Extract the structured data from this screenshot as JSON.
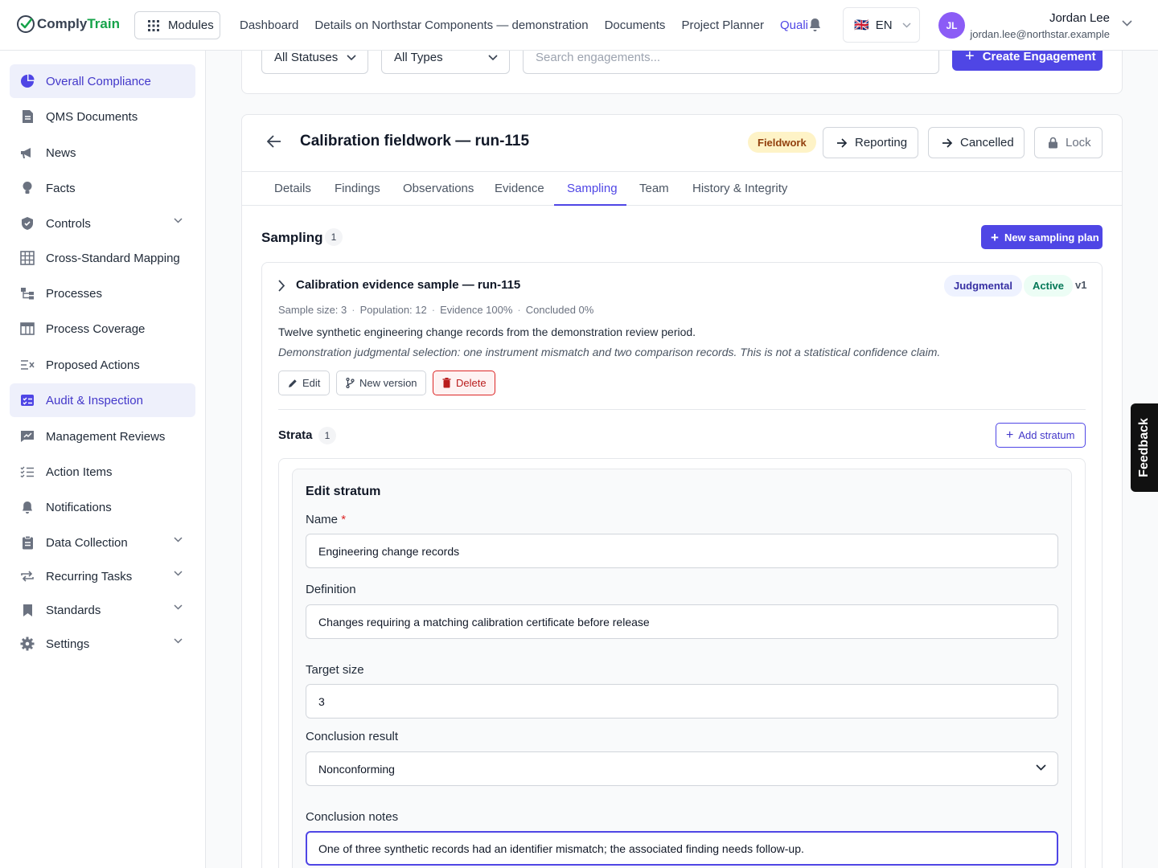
{
  "app": {
    "logo_part1": "Comply",
    "logo_part2": "Train",
    "modules_label": "Modules"
  },
  "topnav": {
    "items": [
      "Dashboard",
      "Details on Northstar Components — demonstration",
      "Documents",
      "Project Planner",
      "Quali"
    ],
    "active_index": 4
  },
  "lang": {
    "flag": "🇬🇧",
    "code": "EN"
  },
  "user": {
    "initials": "JL",
    "name": "Jordan Lee",
    "email": "jordan.lee@northstar.example"
  },
  "sidebar": {
    "items": [
      {
        "label": "Overall Compliance",
        "icon": "pie-chart-icon",
        "active": true
      },
      {
        "label": "QMS Documents",
        "icon": "document-icon"
      },
      {
        "label": "News",
        "icon": "megaphone-icon"
      },
      {
        "label": "Facts",
        "icon": "lightbulb-icon"
      },
      {
        "label": "Controls",
        "icon": "shield-icon",
        "expandable": true
      },
      {
        "label": "Cross-Standard Mapping",
        "icon": "grid-icon"
      },
      {
        "label": "Processes",
        "icon": "process-icon"
      },
      {
        "label": "Process Coverage",
        "icon": "table-icon"
      },
      {
        "label": "Proposed Actions",
        "icon": "list-x-icon"
      },
      {
        "label": "Audit & Inspection",
        "icon": "checklist-icon",
        "active": true
      },
      {
        "label": "Management Reviews",
        "icon": "chart-icon"
      },
      {
        "label": "Action Items",
        "icon": "list-check-icon"
      },
      {
        "label": "Notifications",
        "icon": "bell-icon"
      },
      {
        "label": "Data Collection",
        "icon": "clipboard-icon",
        "expandable": true
      },
      {
        "label": "Recurring Tasks",
        "icon": "repeat-icon",
        "expandable": true
      },
      {
        "label": "Standards",
        "icon": "bookmark-icon",
        "expandable": true
      },
      {
        "label": "Settings",
        "icon": "gear-icon",
        "expandable": true
      }
    ]
  },
  "filters": {
    "status": "All Statuses",
    "type": "All Types",
    "search_placeholder": "Search engagements...",
    "create_label": "Create Engagement"
  },
  "engagement": {
    "title": "Calibration fieldwork — run-115",
    "status_badge": "Fieldwork",
    "buttons": {
      "reporting": "Reporting",
      "cancelled": "Cancelled",
      "lock": "Lock"
    },
    "tabs": [
      "Details",
      "Findings",
      "Observations",
      "Evidence",
      "Sampling",
      "Team",
      "History & Integrity"
    ],
    "active_tab": "Sampling"
  },
  "sampling": {
    "title": "Sampling",
    "count": "1",
    "new_plan_label": "New sampling plan",
    "plan": {
      "title": "Calibration evidence sample — run-115",
      "method": "Judgmental",
      "status": "Active",
      "version": "v1",
      "sample_size": "Sample size: 3",
      "population": "Population: 12",
      "evidence": "Evidence 100%",
      "concluded": "Concluded 0%",
      "description": "Twelve synthetic engineering change records from the demonstration review period.",
      "note": "Demonstration judgmental selection: one instrument mismatch and two comparison records. This is not a statistical confidence claim.",
      "edit_label": "Edit",
      "new_version_label": "New version",
      "delete_label": "Delete"
    },
    "strata": {
      "title": "Strata",
      "count": "1",
      "add_label": "Add stratum"
    }
  },
  "edit_stratum": {
    "title": "Edit stratum",
    "name_label": "Name",
    "required_mark": "*",
    "name_value": "Engineering change records",
    "definition_label": "Definition",
    "definition_value": "Changes requiring a matching calibration certificate before release",
    "target_label": "Target size",
    "target_value": "3",
    "conclusion_label": "Conclusion result",
    "conclusion_value": "Nonconforming",
    "notes_label": "Conclusion notes",
    "notes_value": "One of three synthetic records had an identifier mismatch; the associated finding needs follow-up."
  },
  "feedback_label": "Feedback",
  "colors": {
    "accent": "#4f46e5",
    "brand_green": "#16a34a",
    "fieldwork_badge": "#fef3c7",
    "active_green": "#047857",
    "delete_red": "#dc2626"
  }
}
